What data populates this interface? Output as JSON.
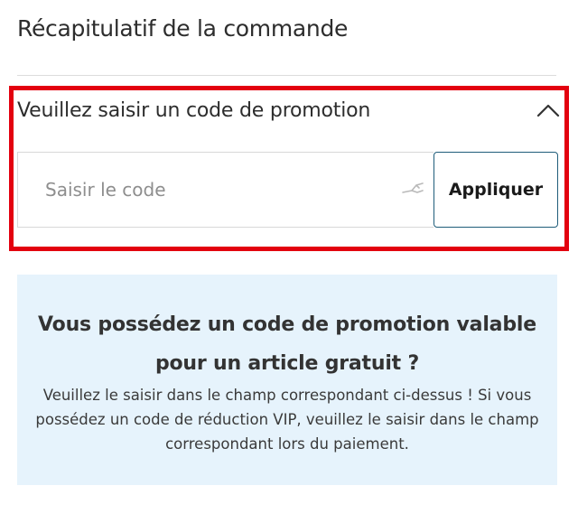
{
  "order_summary": {
    "title": "Récapitulatif de la commande"
  },
  "promo": {
    "header_label": "Veuillez saisir un code de promotion",
    "expanded": true,
    "toggle_icon": "chevron-up-icon",
    "code_input": {
      "placeholder": "Saisir le code",
      "value": "",
      "icon": "key-icon"
    },
    "apply_label": "Appliquer",
    "highlight_color": "#e3000f"
  },
  "info_box": {
    "heading": "Vous possédez un code de promotion valable pour un article gratuit ?",
    "text": "Veuillez le saisir dans le champ correspondant ci-dessus ! Si vous possédez un code de réduction VIP, veuillez le saisir dans le champ correspondant lors du paiement.",
    "background": "#e6f3fc"
  }
}
